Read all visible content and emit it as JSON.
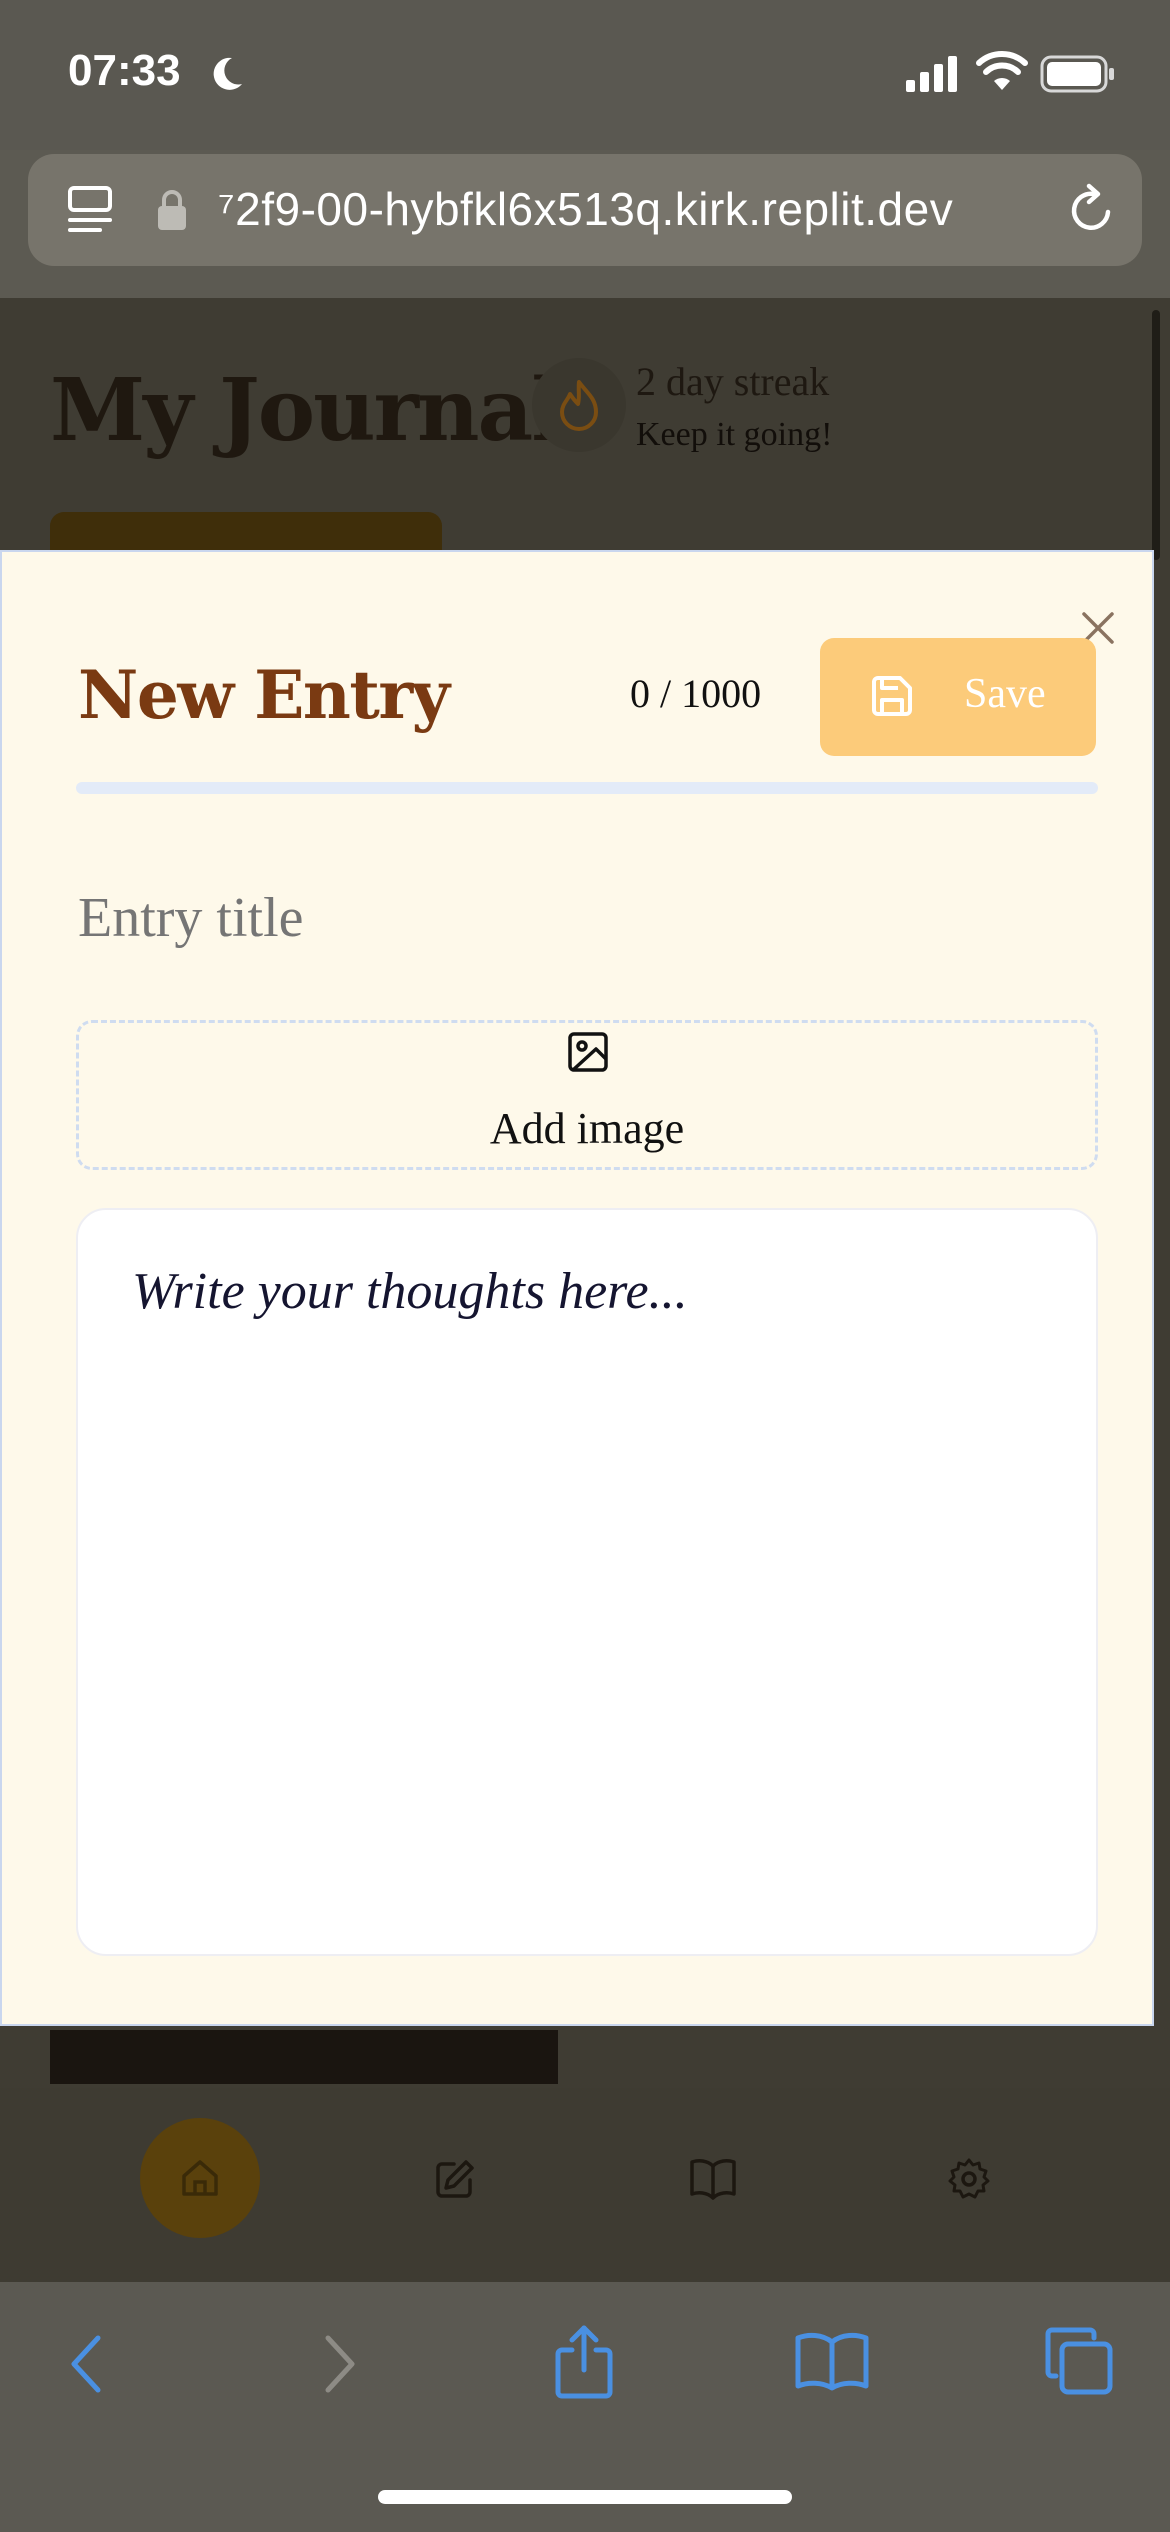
{
  "status_bar": {
    "time": "07:33"
  },
  "browser": {
    "url": "⁷2f9-00-hybfkl6x513q.kirk.replit.dev"
  },
  "background_page": {
    "title": "My Journal",
    "streak_text": "2 day streak",
    "streak_subtext": "Keep it going!"
  },
  "modal": {
    "title": "New Entry",
    "char_count": "0 / 1000",
    "save_label": "Save",
    "entry_title_placeholder": "Entry title",
    "add_image_label": "Add image",
    "body_placeholder": "Write your thoughts here..."
  },
  "colors": {
    "modal_bg": "#fef9ea",
    "title_brown": "#7a3a12",
    "save_button": "#fccb7a",
    "safari_blue": "#4a90e2"
  },
  "icons": {
    "status": [
      "moon-icon",
      "signal-icon",
      "wifi-icon",
      "battery-icon"
    ],
    "url_bar": [
      "reader-icon",
      "lock-icon",
      "reload-icon"
    ],
    "bottom_nav": [
      "home-icon",
      "edit-icon",
      "book-icon",
      "gear-icon"
    ],
    "toolbar": [
      "back-icon",
      "forward-icon",
      "share-icon",
      "bookmarks-icon",
      "tabs-icon"
    ]
  }
}
